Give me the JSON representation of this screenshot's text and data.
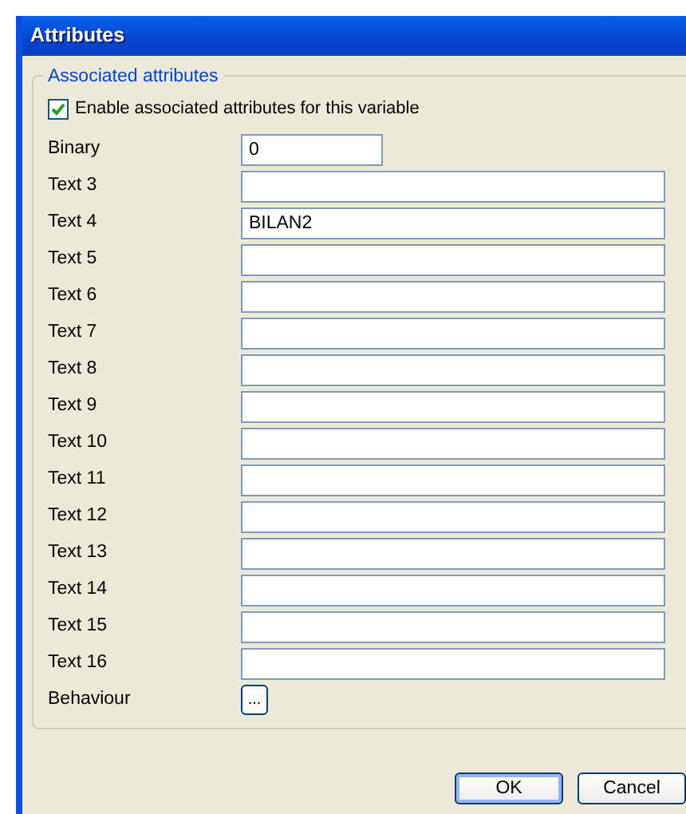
{
  "window": {
    "title": "Attributes"
  },
  "group": {
    "title": "Associated attributes",
    "checkbox": {
      "label": "Enable associated attributes for this variable",
      "checked": true
    }
  },
  "fields": [
    {
      "label": "Binary",
      "value": "0",
      "kind": "short"
    },
    {
      "label": "Text 3",
      "kind": "text"
    },
    {
      "label": "Text 4",
      "value": "BILAN2",
      "kind": "text"
    },
    {
      "label": "Text 5",
      "kind": "text"
    },
    {
      "label": "Text 6",
      "kind": "text"
    },
    {
      "label": "Text 7",
      "kind": "text"
    },
    {
      "label": "Text 8",
      "kind": "text"
    },
    {
      "label": "Text 9",
      "kind": "text"
    },
    {
      "label": "Text 10",
      "kind": "text"
    },
    {
      "label": "Text 11",
      "kind": "text"
    },
    {
      "label": "Text 12",
      "kind": "text"
    },
    {
      "label": "Text 13",
      "kind": "text"
    },
    {
      "label": "Text 14",
      "kind": "text"
    },
    {
      "label": "Text 15",
      "kind": "text"
    },
    {
      "label": "Text 16",
      "kind": "text"
    },
    {
      "label": "Behaviour",
      "value": "...",
      "kind": "button"
    }
  ],
  "buttons": [
    {
      "label": "OK",
      "default": true
    },
    {
      "label": "Cancel",
      "default": false
    }
  ]
}
